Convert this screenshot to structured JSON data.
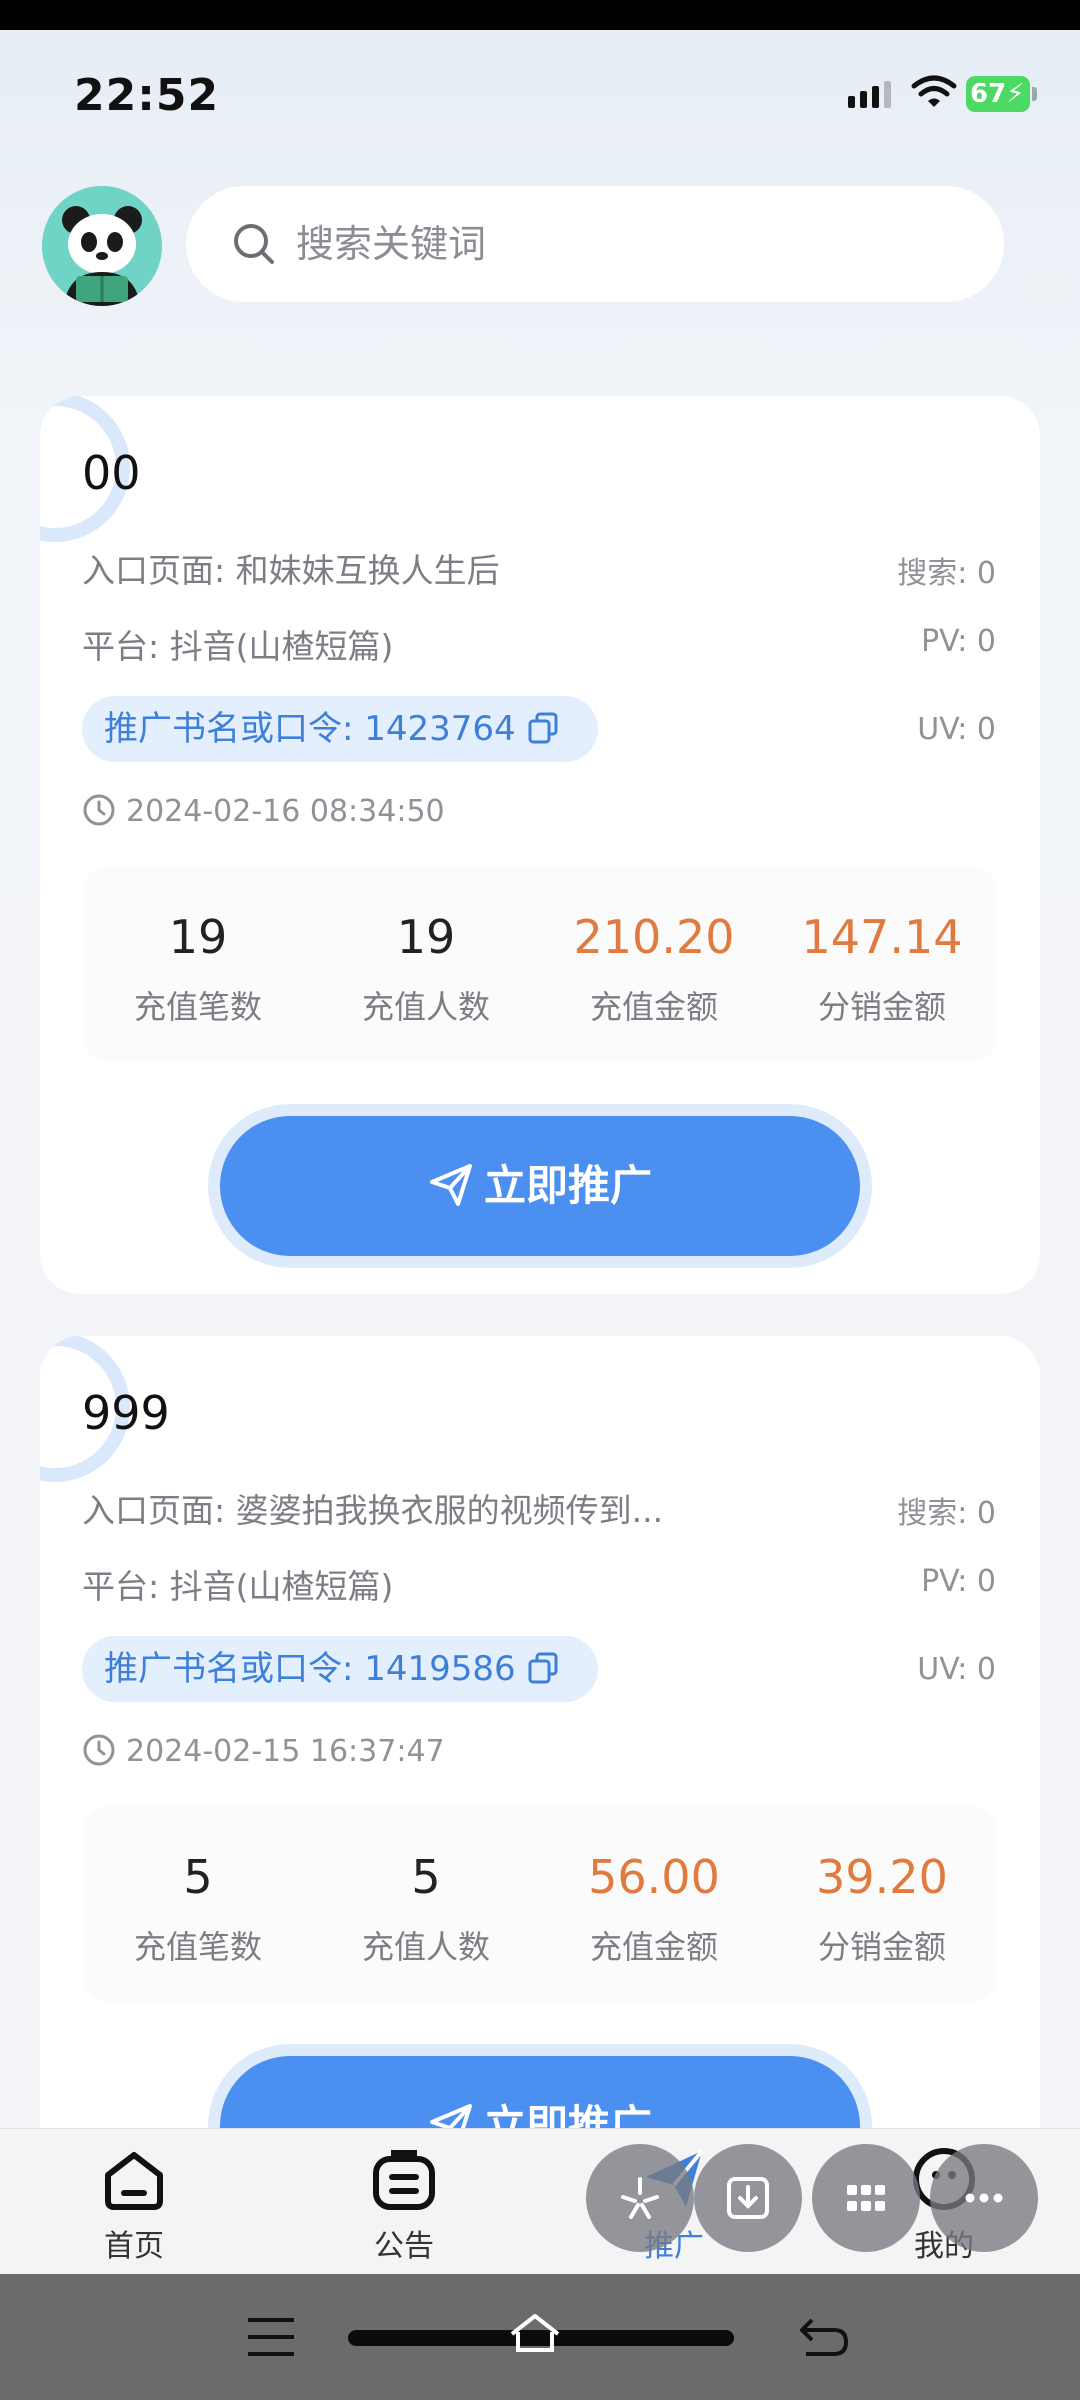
{
  "status_bar": {
    "time": "22:52",
    "battery": "67"
  },
  "search": {
    "placeholder": "搜索关键词"
  },
  "cards": [
    {
      "title": "00",
      "entry_page": "入口页面: 和妹妹互换人生后",
      "platform": "平台: 抖音(山楂短篇)",
      "promo_code": "推广书名或口令: 1423764",
      "datetime": "2024-02-16 08:34:50",
      "search_count": "搜索: 0",
      "pv": "PV: 0",
      "uv": "UV: 0",
      "stats": [
        {
          "value": "19",
          "label": "充值笔数"
        },
        {
          "value": "19",
          "label": "充值人数"
        },
        {
          "value": "210.20",
          "label": "充值金额"
        },
        {
          "value": "147.14",
          "label": "分销金额"
        }
      ],
      "button": "立即推广"
    },
    {
      "title": "999",
      "entry_page": "入口页面: 婆婆拍我换衣服的视频传到...",
      "platform": "平台: 抖音(山楂短篇)",
      "promo_code": "推广书名或口令: 1419586",
      "datetime": "2024-02-15 16:37:47",
      "search_count": "搜索: 0",
      "pv": "PV: 0",
      "uv": "UV: 0",
      "stats": [
        {
          "value": "5",
          "label": "充值笔数"
        },
        {
          "value": "5",
          "label": "充值人数"
        },
        {
          "value": "56.00",
          "label": "充值金额"
        },
        {
          "value": "39.20",
          "label": "分销金额"
        }
      ],
      "button": "立即推广"
    }
  ],
  "bottom_nav": [
    {
      "label": "首页",
      "icon": "home-icon"
    },
    {
      "label": "公告",
      "icon": "notice-icon"
    },
    {
      "label": "推广",
      "icon": "send-icon",
      "active": true
    },
    {
      "label": "我的",
      "icon": "user-icon"
    }
  ],
  "colors": {
    "accent": "#4b8ff0",
    "amount": "#e07a3e",
    "promo_tag_bg": "#e4effd"
  }
}
